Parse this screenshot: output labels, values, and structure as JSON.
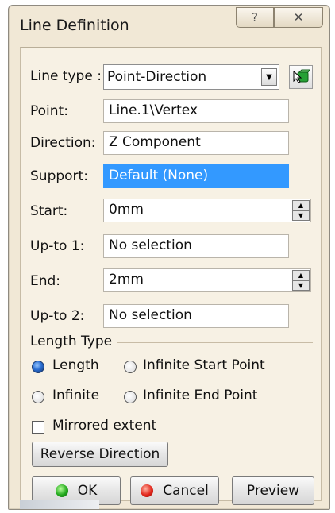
{
  "window": {
    "title": "Line Definition",
    "help_glyph": "?",
    "close_glyph": "✕"
  },
  "form": {
    "line_type": {
      "label": "Line type :",
      "value": "Point-Direction"
    },
    "point": {
      "label": "Point:",
      "value": "Line.1\\Vertex"
    },
    "direction": {
      "label": "Direction:",
      "value": "Z Component"
    },
    "support": {
      "label": "Support:",
      "value": "Default (None)"
    },
    "start": {
      "label": "Start:",
      "value": "0mm"
    },
    "up_to_1": {
      "label": "Up-to 1:",
      "value": "No selection"
    },
    "end": {
      "label": "End:",
      "value": "2mm"
    },
    "up_to_2": {
      "label": "Up-to 2:",
      "value": "No selection"
    }
  },
  "length_type": {
    "heading": "Length Type",
    "options": [
      "Length",
      "Infinite Start Point",
      "Infinite",
      "Infinite End Point"
    ],
    "selected": "Length"
  },
  "mirrored_extent": {
    "label": "Mirrored extent",
    "checked": false
  },
  "buttons": {
    "reverse_direction": "Reverse Direction",
    "ok": "OK",
    "cancel": "Cancel",
    "preview": "Preview"
  },
  "colors": {
    "dialog_bg": "#f1e8d6",
    "selection": "#3399ff"
  }
}
